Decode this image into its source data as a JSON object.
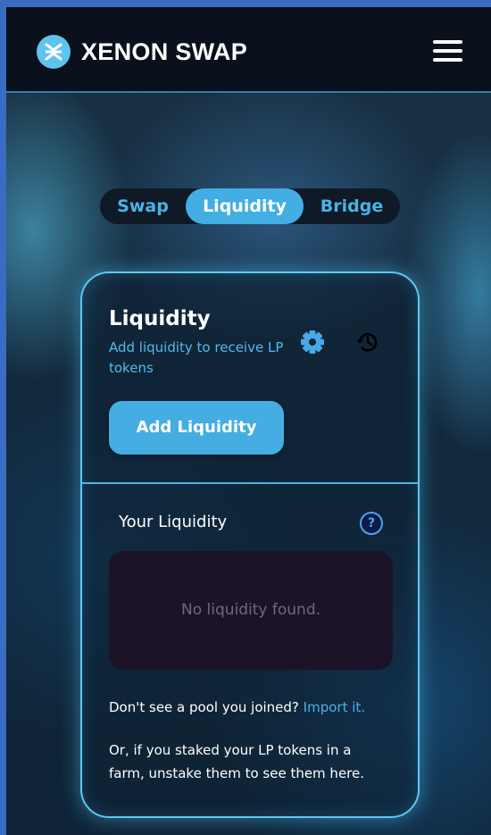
{
  "header": {
    "brand": "XENON SWAP",
    "logo_icon": "xenon-logo-icon",
    "menu_icon": "hamburger-menu-icon",
    "background": "#0b111c",
    "logo_color": "#5fc3ee"
  },
  "tabs": [
    {
      "label": "Swap",
      "active": false
    },
    {
      "label": "Liquidity",
      "active": true
    },
    {
      "label": "Bridge",
      "active": false
    }
  ],
  "card": {
    "title": "Liquidity",
    "subtitle": "Add liquidity to receive LP tokens",
    "settings_icon": "gear-icon",
    "history_icon": "history-icon",
    "add_button": "Add Liquidity",
    "your_liquidity_label": "Your Liquidity",
    "help_icon": "question-mark-icon",
    "help_glyph": "?",
    "empty_message": "No liquidity found.",
    "pool_prompt": "Don't see a pool you joined?",
    "import_link": "Import it.",
    "farm_note": "Or, if you staked your LP tokens in a farm, unstake them to see them here."
  },
  "colors": {
    "accent": "#45ade2",
    "link": "#4ab3e8",
    "card_border": "#5cc8f2",
    "empty_box": "#1c1329"
  }
}
